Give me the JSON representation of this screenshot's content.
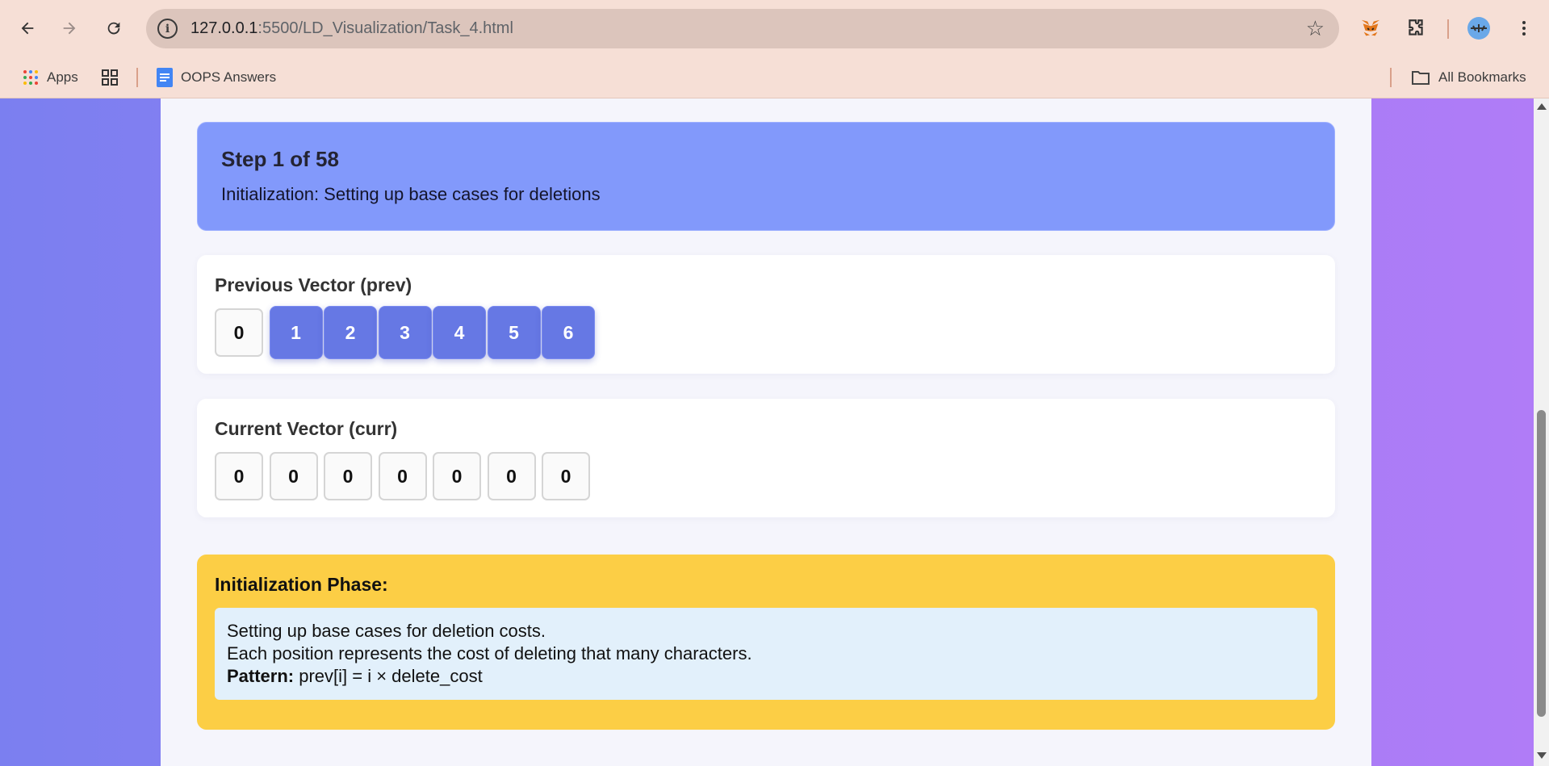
{
  "browser": {
    "url_host": "127.0.0.1",
    "url_rest": ":5500/LD_Visualization/Task_4.html",
    "bookmarks": {
      "apps_label": "Apps",
      "oops_label": "OOPS Answers",
      "all_bookmarks_label": "All Bookmarks"
    }
  },
  "step": {
    "title": "Step 1 of 58",
    "description": "Initialization: Setting up base cases for deletions"
  },
  "prev_vector": {
    "title": "Previous Vector (prev)",
    "cells": [
      {
        "value": "0",
        "active": false
      },
      {
        "value": "1",
        "active": true
      },
      {
        "value": "2",
        "active": true
      },
      {
        "value": "3",
        "active": true
      },
      {
        "value": "4",
        "active": true
      },
      {
        "value": "5",
        "active": true
      },
      {
        "value": "6",
        "active": true
      }
    ]
  },
  "curr_vector": {
    "title": "Current Vector (curr)",
    "cells": [
      {
        "value": "0",
        "active": false
      },
      {
        "value": "0",
        "active": false
      },
      {
        "value": "0",
        "active": false
      },
      {
        "value": "0",
        "active": false
      },
      {
        "value": "0",
        "active": false
      },
      {
        "value": "0",
        "active": false
      },
      {
        "value": "0",
        "active": false
      }
    ]
  },
  "phase": {
    "title": "Initialization Phase:",
    "line1": "Setting up base cases for deletion costs.",
    "line2": "Each position represents the cost of deleting that many characters.",
    "pattern_label": "Pattern:",
    "pattern_text": " prev[i] = i × delete_cost"
  },
  "colors": {
    "step_box": "#8299fb",
    "active_cell": "#6678e4",
    "phase_box": "#fcce45",
    "phase_inner": "#e2f0fb"
  }
}
